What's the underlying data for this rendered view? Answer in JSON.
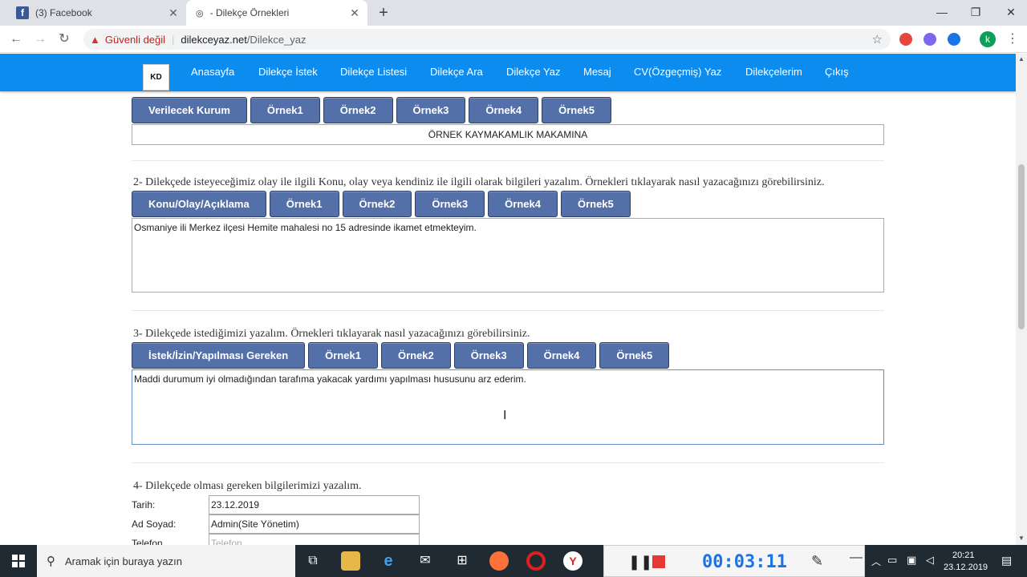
{
  "browser": {
    "tabs": [
      {
        "title": "(3) Facebook",
        "icon": "facebook-icon"
      },
      {
        "title": "- Dilekçe Örnekleri",
        "icon": "site-icon"
      }
    ],
    "new_tab": "+",
    "security_label": "Güvenli değil",
    "url_host": "dilekceyaz.net",
    "url_path": "/Dilekce_yaz",
    "avatar_letter": "k"
  },
  "site": {
    "logo_text": "KD",
    "nav": [
      "Anasayfa",
      "Dilekçe İstek",
      "Dilekçe Listesi",
      "Dilekçe Ara",
      "Dilekçe Yaz",
      "Mesaj",
      "CV(Özgeçmiş) Yaz",
      "Dilekçelerim",
      "Çıkış"
    ],
    "nav_color": "#0d8cf0",
    "button_color": "#5470a8"
  },
  "section1": {
    "buttons": [
      "Verilecek Kurum",
      "Örnek1",
      "Örnek2",
      "Örnek3",
      "Örnek4",
      "Örnek5"
    ],
    "value": "ÖRNEK KAYMAKAMLIK MAKAMINA"
  },
  "section2": {
    "title": "2- Dilekçede isteyeceğimiz olay ile ilgili Konu, olay veya kendiniz ile ilgili olarak bilgileri yazalım. Örnekleri tıklayarak nasıl yazacağınızı görebilirsiniz.",
    "buttons": [
      "Konu/Olay/Açıklama",
      "Örnek1",
      "Örnek2",
      "Örnek3",
      "Örnek4",
      "Örnek5"
    ],
    "value": "Osmaniye ili Merkez ilçesi Hemite mahalesi no 15 adresinde ikamet etmekteyim."
  },
  "section3": {
    "title": "3- Dilekçede istediğimizi yazalım. Örnekleri tıklayarak nasıl yazacağınızı görebilirsiniz.",
    "buttons": [
      "İstek/İzin/Yapılması Gereken",
      "Örnek1",
      "Örnek2",
      "Örnek3",
      "Örnek4",
      "Örnek5"
    ],
    "value": "Maddi durumum iyi olmadığından tarafıma yakacak yardımı yapılması hususunu arz ederim."
  },
  "section4": {
    "title": "4- Dilekçede olması gereken bilgilerimizi yazalım.",
    "fields": [
      {
        "label": "Tarih:",
        "value": "23.12.2019",
        "placeholder": ""
      },
      {
        "label": "Ad Soyad:",
        "value": "Admin(Site Yönetim)",
        "placeholder": ""
      },
      {
        "label": "Telefon",
        "value": "",
        "placeholder": "Telefon.."
      }
    ]
  },
  "taskbar": {
    "search_placeholder": "Aramak için buraya yazın",
    "recorder_time": "00:03:11",
    "clock_time": "20:21",
    "clock_date": "23.12.2019"
  }
}
